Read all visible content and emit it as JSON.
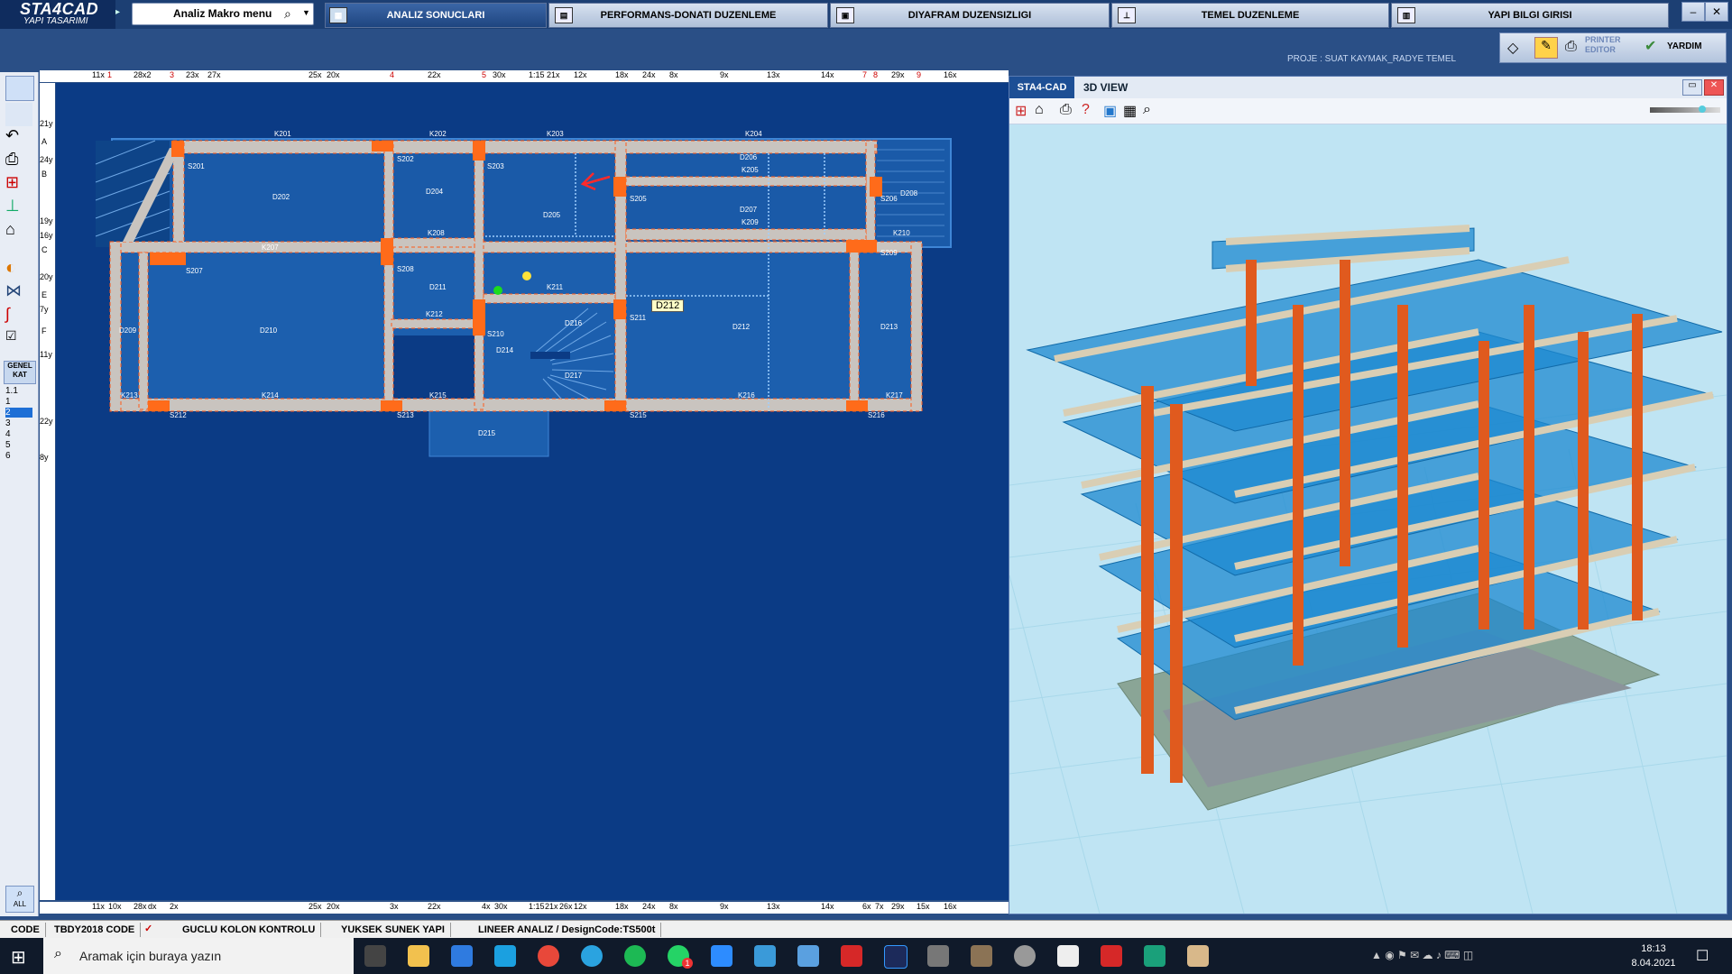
{
  "app": {
    "logo_main": "STA4CAD",
    "logo_sub": "YAPI TASARIMI"
  },
  "menu": {
    "combo_label": "Analiz Makro menu"
  },
  "tabs": [
    {
      "label": "ANALIZ SONUCLARI",
      "active": true
    },
    {
      "label": "PERFORMANS-DONATI DUZENLEME",
      "active": false
    },
    {
      "label": "DIYAFRAM DUZENSIZLIGI",
      "active": false
    },
    {
      "label": "TEMEL DUZENLEME",
      "active": false
    },
    {
      "label": "YAPI BILGI GIRISI",
      "active": false
    }
  ],
  "project_label": "PROJE : SUAT KAYMAK_RADYE TEMEL",
  "right_tools": {
    "printer_editor": "PRINTER\nEDITOR",
    "help": "YARDIM"
  },
  "left_panel": {
    "genel_kat": "GENEL\nKAT",
    "floors": [
      "1.1",
      "1",
      "2",
      "3",
      "4",
      "5",
      "6"
    ],
    "selected_floor": "2",
    "all_label": "ALL"
  },
  "ruler_top": [
    "11x",
    "1",
    "28x2",
    "3",
    "23x",
    "27x",
    "25x",
    "20x",
    "4",
    "22x",
    "5",
    "30x",
    "1:15",
    "21x",
    "12x",
    "18x",
    "24x",
    "8x",
    "9x",
    "13x",
    "14x",
    "7",
    "8",
    "29x",
    "9",
    "16x"
  ],
  "ruler_bottom": [
    "11x",
    "10x",
    "28x",
    "dx",
    "2x",
    "25x",
    "20x",
    "3x",
    "22x",
    "4x",
    "30x",
    "1:15",
    "21x",
    "26x",
    "12x",
    "18x",
    "24x",
    "8x",
    "9x",
    "13x",
    "14x",
    "6x",
    "7x",
    "29x",
    "15x",
    "16x"
  ],
  "ruler_left": [
    "21y",
    "A",
    "24y",
    "B",
    "19y",
    "16y",
    "C",
    "20y",
    "E",
    "7y",
    "F",
    "11y",
    "22y",
    "8y"
  ],
  "plan": {
    "beams": [
      "K201",
      "K202",
      "K203",
      "K204",
      "K205",
      "K207",
      "K208",
      "K209",
      "K210",
      "K211",
      "K212",
      "K214",
      "K215",
      "K216",
      "K217",
      "K213"
    ],
    "columns": [
      "S201",
      "S202",
      "S203",
      "S205",
      "S206",
      "S207",
      "S208",
      "S209",
      "S210",
      "S211",
      "S212",
      "S213",
      "S215",
      "S216"
    ],
    "slabs": [
      "D202",
      "D204",
      "D205",
      "D206",
      "D207",
      "D208",
      "D209",
      "D210",
      "D211",
      "D212",
      "D213",
      "D214",
      "D215",
      "D216",
      "D217"
    ],
    "highlight_label": "D212"
  },
  "view3d": {
    "tab": "STA4-CAD",
    "title": "3D VIEW"
  },
  "status": {
    "cells": [
      "CODE",
      "TBDY2018 CODE",
      "GUCLU KOLON KONTROLU",
      "YUKSEK SUNEK YAPI",
      "LINEER ANALIZ / DesignCode:TS500t"
    ]
  },
  "taskbar": {
    "search_placeholder": "Aramak için buraya yazın",
    "time": "18:13",
    "date": "8.04.2021",
    "whatsapp_badge": "1"
  },
  "colors": {
    "plan_bg": "#0b3b85",
    "slab": "#1c5fae",
    "beam": "#c9c4bf",
    "column": "#ff6b1a",
    "view_bg": "#bfe4f3"
  }
}
